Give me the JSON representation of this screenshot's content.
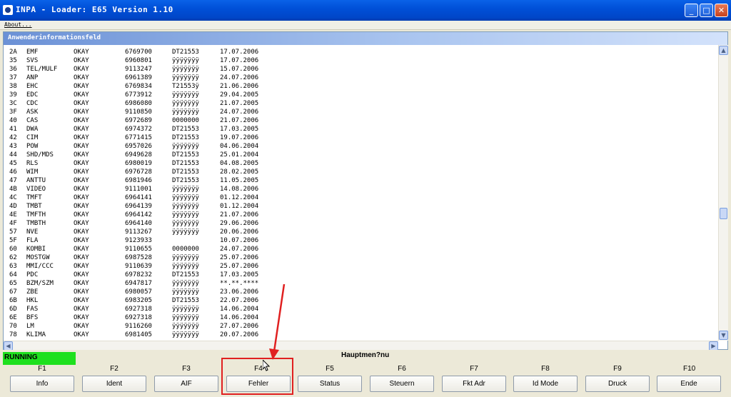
{
  "window": {
    "title": "INPA - Loader: E65 Version 1.10"
  },
  "menu": {
    "about": "About..."
  },
  "panel": {
    "header": "Anwenderinformationsfeld"
  },
  "rows": [
    [
      "2A",
      "EMF",
      "OKAY",
      "6769700",
      "DT21553",
      "17.07.2006"
    ],
    [
      "35",
      "SVS",
      "OKAY",
      "6960801",
      "ÿÿÿÿÿÿÿ",
      "17.07.2006"
    ],
    [
      "36",
      "TEL/MULF",
      "OKAY",
      "9113247",
      "ÿÿÿÿÿÿÿ",
      "15.07.2006"
    ],
    [
      "37",
      "ANP",
      "OKAY",
      "6961389",
      "ÿÿÿÿÿÿÿ",
      "24.07.2006"
    ],
    [
      "38",
      "EHC",
      "OKAY",
      "6769834",
      "T21553ÿ",
      "21.06.2006"
    ],
    [
      "39",
      "EDC",
      "OKAY",
      "6773912",
      "ÿÿÿÿÿÿÿ",
      "29.04.2005"
    ],
    [
      "3C",
      "CDC",
      "OKAY",
      "6986080",
      "ÿÿÿÿÿÿÿ",
      "21.07.2005"
    ],
    [
      "3F",
      "ASK",
      "OKAY",
      "9110850",
      "ÿÿÿÿÿÿÿ",
      "24.07.2006"
    ],
    [
      "40",
      "CAS",
      "OKAY",
      "6972689",
      "0000000",
      "21.07.2006"
    ],
    [
      "41",
      "DWA",
      "OKAY",
      "6974372",
      "DT21553",
      "17.03.2005"
    ],
    [
      "42",
      "CIM",
      "OKAY",
      "6771415",
      "DT21553",
      "19.07.2006"
    ],
    [
      "43",
      "POW",
      "OKAY",
      "6957026",
      "ÿÿÿÿÿÿÿ",
      "04.06.2004"
    ],
    [
      "44",
      "SHD/MDS",
      "OKAY",
      "6949628",
      "DT21553",
      "25.01.2004"
    ],
    [
      "45",
      "RLS",
      "OKAY",
      "6980019",
      "DT21553",
      "04.08.2005"
    ],
    [
      "46",
      "WIM",
      "OKAY",
      "6976728",
      "DT21553",
      "28.02.2005"
    ],
    [
      "47",
      "ANTTU",
      "OKAY",
      "6981946",
      "DT21553",
      "11.05.2005"
    ],
    [
      "4B",
      "VIDEO",
      "OKAY",
      "9111001",
      "ÿÿÿÿÿÿÿ",
      "14.08.2006"
    ],
    [
      "4C",
      "TMFT",
      "OKAY",
      "6964141",
      "ÿÿÿÿÿÿÿ",
      "01.12.2004"
    ],
    [
      "4D",
      "TMBT",
      "OKAY",
      "6964139",
      "ÿÿÿÿÿÿÿ",
      "01.12.2004"
    ],
    [
      "4E",
      "TMFTH",
      "OKAY",
      "6964142",
      "ÿÿÿÿÿÿÿ",
      "21.07.2006"
    ],
    [
      "4F",
      "TMBTH",
      "OKAY",
      "6964140",
      "ÿÿÿÿÿÿÿ",
      "29.06.2006"
    ],
    [
      "57",
      "NVE",
      "OKAY",
      "9113267",
      "ÿÿÿÿÿÿÿ",
      "20.06.2006"
    ],
    [
      "5F",
      "FLA",
      "OKAY",
      "9123933",
      "",
      "10.07.2006"
    ],
    [
      "60",
      "KOMBI",
      "OKAY",
      "9110655",
      "0000000",
      "24.07.2006"
    ],
    [
      "62",
      "MOSTGW",
      "OKAY",
      "6987528",
      "ÿÿÿÿÿÿÿ",
      "25.07.2006"
    ],
    [
      "63",
      "MMI/CCC",
      "OKAY",
      "9110639",
      "ÿÿÿÿÿÿÿ",
      "25.07.2006"
    ],
    [
      "64",
      "PDC",
      "OKAY",
      "6978232",
      "DT21553",
      "17.03.2005"
    ],
    [
      "65",
      "BZM/SZM",
      "OKAY",
      "6947817",
      "ÿÿÿÿÿÿÿ",
      "**.**.****"
    ],
    [
      "67",
      "ZBE",
      "OKAY",
      "6980057",
      "ÿÿÿÿÿÿÿ",
      "23.06.2006"
    ],
    [
      "6B",
      "HKL",
      "OKAY",
      "6983205",
      "DT21553",
      "22.07.2006"
    ],
    [
      "6D",
      "FAS",
      "OKAY",
      "6927318",
      "ÿÿÿÿÿÿÿ",
      "14.06.2004"
    ],
    [
      "6E",
      "BFS",
      "OKAY",
      "6927318",
      "ÿÿÿÿÿÿÿ",
      "14.06.2004"
    ],
    [
      "70",
      "LM",
      "OKAY",
      "9116260",
      "ÿÿÿÿÿÿÿ",
      "27.07.2006"
    ],
    [
      "78",
      "KLIMA",
      "OKAY",
      "6981405",
      "ÿÿÿÿÿÿÿ",
      "20.07.2006"
    ]
  ],
  "status": {
    "text": "RUNNING",
    "color": "#1ee01e"
  },
  "menu_title": "Hauptmen?nu",
  "fkeys": [
    {
      "key": "F1",
      "label": "Info"
    },
    {
      "key": "F2",
      "label": "Ident"
    },
    {
      "key": "F3",
      "label": "AIF"
    },
    {
      "key": "F4",
      "label": "Fehler"
    },
    {
      "key": "F5",
      "label": "Status"
    },
    {
      "key": "F6",
      "label": "Steuern"
    },
    {
      "key": "F7",
      "label": "Fkt Adr"
    },
    {
      "key": "F8",
      "label": "Id Mode"
    },
    {
      "key": "F9",
      "label": "Druck"
    },
    {
      "key": "F10",
      "label": "Ende"
    }
  ],
  "colors": {
    "annotation": "#e02020",
    "title_bar": "#0050d8",
    "panel_header": "#6b91d6"
  }
}
